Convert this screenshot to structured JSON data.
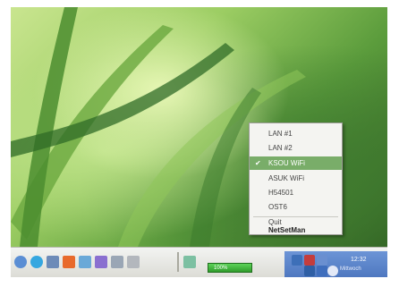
{
  "tray_menu": {
    "items": [
      {
        "label": "LAN #1",
        "checked": false,
        "selected": false
      },
      {
        "label": "LAN #2",
        "checked": false,
        "selected": false
      },
      {
        "label": "KSOU WiFi",
        "checked": true,
        "selected": true
      },
      {
        "label": "ASUK WiFi",
        "checked": false,
        "selected": false
      },
      {
        "label": "H54501",
        "checked": false,
        "selected": false
      },
      {
        "label": "OST6",
        "checked": false,
        "selected": false
      }
    ],
    "quit_label": "Quit",
    "app_label": "NetSetMan",
    "check_glyph": "✔"
  },
  "taskbar": {
    "battery_text": "100%",
    "battery_level_percent": 100,
    "apple_glyph": "",
    "clock": "12:32",
    "date_text": "Mittwoch"
  },
  "colors": {
    "menu_highlight": "#79ad69",
    "tray_blue": "#5a82c8",
    "battery_green": "#3aaa35"
  },
  "icons": {
    "quicklaunch": [
      "pidgin-icon",
      "skype-icon",
      "network-icon",
      "mail-icon",
      "chat-icon",
      "music-icon",
      "mic-icon",
      "gear-icon"
    ],
    "tray": [
      "network-tray-icon",
      "bluetooth-icon",
      "volume-icon"
    ]
  }
}
